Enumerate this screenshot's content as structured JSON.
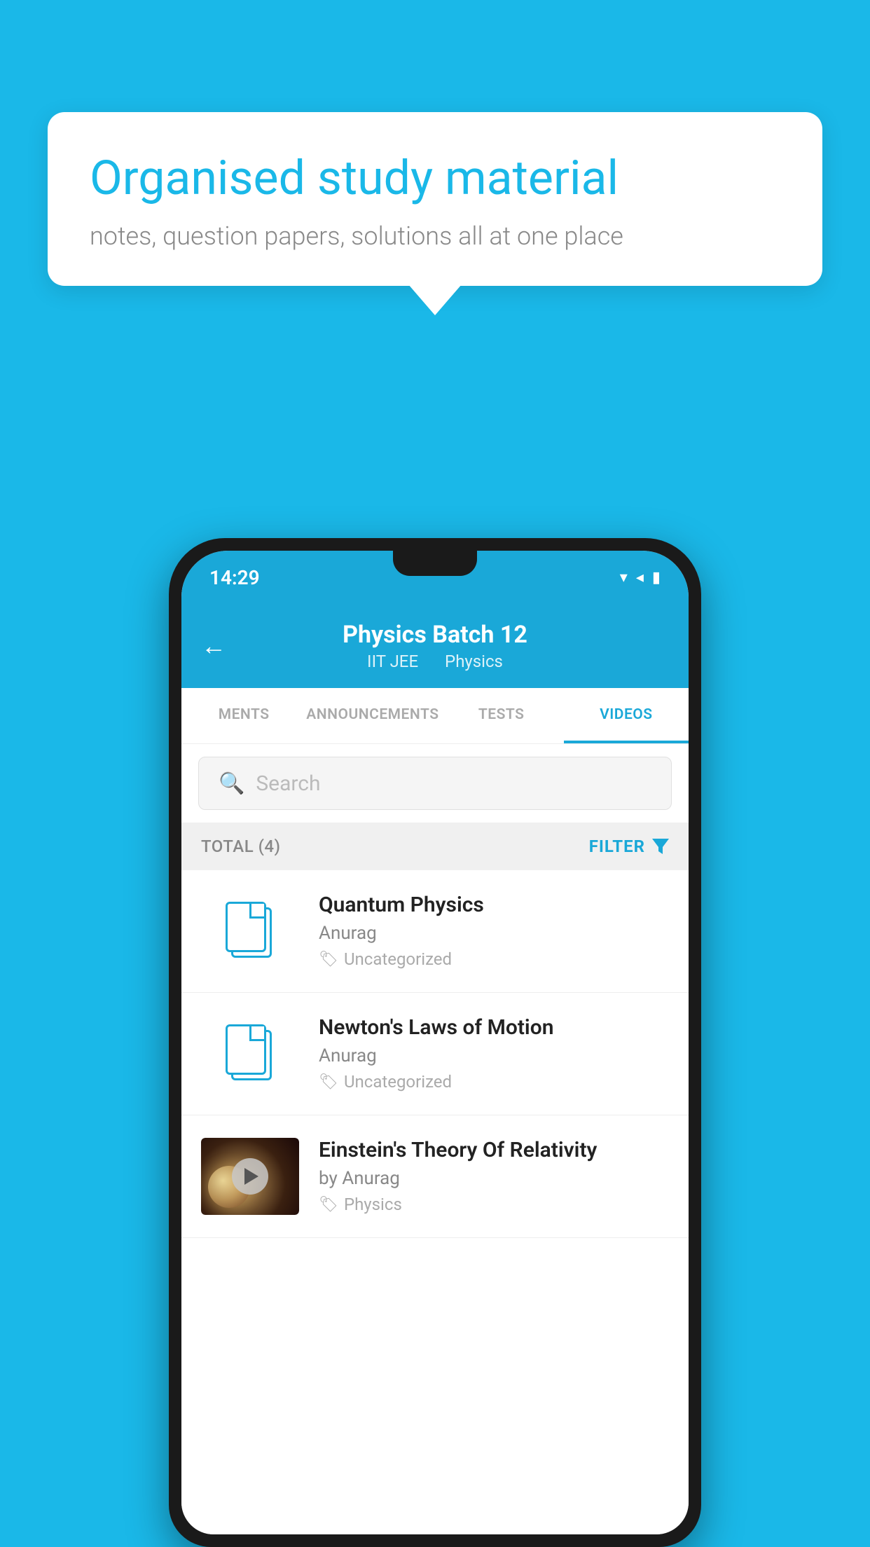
{
  "background_color": "#1ab8e8",
  "speech_bubble": {
    "title": "Organised study material",
    "subtitle": "notes, question papers, solutions all at one place"
  },
  "phone": {
    "status_bar": {
      "time": "14:29",
      "icons": [
        "wifi",
        "signal",
        "battery"
      ]
    },
    "app_bar": {
      "back_label": "←",
      "title": "Physics Batch 12",
      "subtitle_parts": [
        "IIT JEE",
        "Physics"
      ]
    },
    "tabs": [
      {
        "label": "MENTS",
        "active": false
      },
      {
        "label": "ANNOUNCEMENTS",
        "active": false
      },
      {
        "label": "TESTS",
        "active": false
      },
      {
        "label": "VIDEOS",
        "active": true
      }
    ],
    "search": {
      "placeholder": "Search"
    },
    "filter_bar": {
      "total": "TOTAL (4)",
      "filter_label": "FILTER"
    },
    "list_items": [
      {
        "title": "Quantum Physics",
        "author": "Anurag",
        "tag": "Uncategorized",
        "type": "file"
      },
      {
        "title": "Newton's Laws of Motion",
        "author": "Anurag",
        "tag": "Uncategorized",
        "type": "file"
      },
      {
        "title": "Einstein's Theory Of Relativity",
        "author": "by Anurag",
        "tag": "Physics",
        "type": "video"
      }
    ]
  }
}
